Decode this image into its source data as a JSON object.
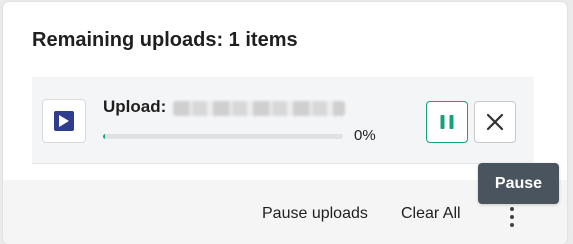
{
  "dialog": {
    "title": "Remaining uploads: 1 items"
  },
  "upload_item": {
    "label": "Upload:",
    "file_icon": "video-file-icon",
    "progress_percent_text": "0%",
    "progress_fraction": 0,
    "pause_icon": "pause-icon",
    "cancel_icon": "close-icon"
  },
  "footer": {
    "pause_uploads_label": "Pause uploads",
    "clear_all_label": "Clear All",
    "more_icon": "more-vertical-icon"
  },
  "tooltip": {
    "text": "Pause"
  },
  "colors": {
    "accent": "#15a27a",
    "file_tile": "#2f3d8e",
    "tooltip_bg": "#4a545f"
  }
}
